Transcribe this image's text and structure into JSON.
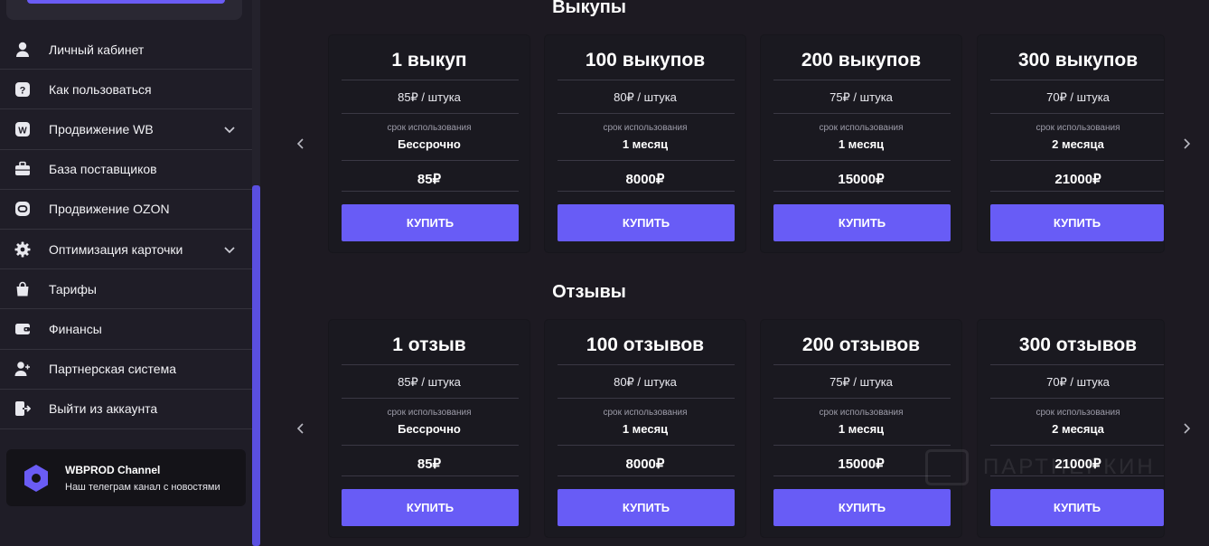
{
  "sidebar": {
    "items": [
      {
        "label": "Личный кабинет",
        "icon": "user-icon",
        "chevron": false
      },
      {
        "label": "Как пользоваться",
        "icon": "help-icon",
        "chevron": false
      },
      {
        "label": "Продвижение WB",
        "icon": "wb-icon",
        "chevron": true
      },
      {
        "label": "База поставщиков",
        "icon": "briefcase-icon",
        "chevron": false
      },
      {
        "label": "Продвижение OZON",
        "icon": "ozon-icon",
        "chevron": false
      },
      {
        "label": "Оптимизация карточки",
        "icon": "gear-icon",
        "chevron": true
      },
      {
        "label": "Тарифы",
        "icon": "bag-icon",
        "chevron": false
      },
      {
        "label": "Финансы",
        "icon": "wallet-icon",
        "chevron": false
      },
      {
        "label": "Партнерская система",
        "icon": "user-add-icon",
        "chevron": false
      },
      {
        "label": "Выйти из аккаунта",
        "icon": "logout-icon",
        "chevron": false
      }
    ],
    "channel": {
      "title": "WBPROD Channel",
      "subtitle": "Наш телеграм канал с новостями",
      "icon": "channel-logo-icon"
    }
  },
  "sections": [
    {
      "title": "Выкупы",
      "cards": [
        {
          "name": "1 выкуп",
          "price_per": "85₽ / штука",
          "term_label": "срок использования",
          "term": "Бессрочно",
          "total": "85₽",
          "button": "КУПИТЬ"
        },
        {
          "name": "100 выкупов",
          "price_per": "80₽ / штука",
          "term_label": "срок использования",
          "term": "1 месяц",
          "total": "8000₽",
          "button": "КУПИТЬ"
        },
        {
          "name": "200 выкупов",
          "price_per": "75₽ / штука",
          "term_label": "срок использования",
          "term": "1 месяц",
          "total": "15000₽",
          "button": "КУПИТЬ"
        },
        {
          "name": "300 выкупов",
          "price_per": "70₽ / штука",
          "term_label": "срок использования",
          "term": "2 месяца",
          "total": "21000₽",
          "button": "КУПИТЬ"
        }
      ]
    },
    {
      "title": "Отзывы",
      "cards": [
        {
          "name": "1 отзыв",
          "price_per": "85₽ / штука",
          "term_label": "срок использования",
          "term": "Бессрочно",
          "total": "85₽",
          "button": "КУПИТЬ"
        },
        {
          "name": "100 отзывов",
          "price_per": "80₽ / штука",
          "term_label": "срок использования",
          "term": "1 месяц",
          "total": "8000₽",
          "button": "КУПИТЬ"
        },
        {
          "name": "200 отзывов",
          "price_per": "75₽ / штука",
          "term_label": "срок использования",
          "term": "1 месяц",
          "total": "15000₽",
          "button": "КУПИТЬ"
        },
        {
          "name": "300 отзывов",
          "price_per": "70₽ / штука",
          "term_label": "срок использования",
          "term": "2 месяца",
          "total": "21000₽",
          "button": "КУПИТЬ"
        }
      ]
    }
  ],
  "watermark": {
    "text": "ПАРТНЕРКИН"
  },
  "colors": {
    "accent": "#685cf6",
    "background": "#1d1a22",
    "sidebar": "#1f1d27",
    "card": "#1a1920"
  }
}
